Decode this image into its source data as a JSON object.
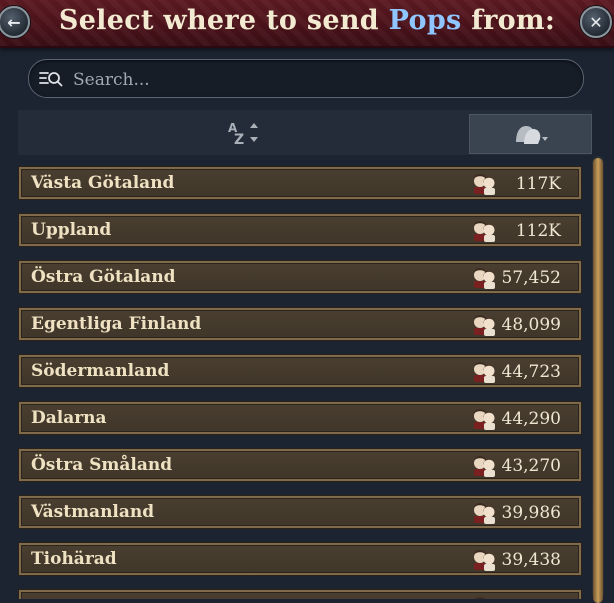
{
  "header": {
    "title_prefix": "Select where to send ",
    "title_accent": "Pops",
    "title_suffix": " from:",
    "back_icon": "←",
    "close_icon": "✕"
  },
  "search": {
    "placeholder": "Search...",
    "value": ""
  },
  "sort": {
    "az_label": "A Z"
  },
  "rows": [
    {
      "name": "Västa Götaland",
      "value": "117K"
    },
    {
      "name": "Uppland",
      "value": "112K"
    },
    {
      "name": "Östra Götaland",
      "value": "57,452"
    },
    {
      "name": "Egentliga Finland",
      "value": "48,099"
    },
    {
      "name": "Södermanland",
      "value": "44,723"
    },
    {
      "name": "Dalarna",
      "value": "44,290"
    },
    {
      "name": "Östra Småland",
      "value": "43,270"
    },
    {
      "name": "Västmanland",
      "value": "39,986"
    },
    {
      "name": "Tiohärad",
      "value": "39,438"
    },
    {
      "name": "",
      "value": ""
    }
  ],
  "colors": {
    "title_accent": "#8fc6ff",
    "row_bg": "#463b2d",
    "row_border": "#7f6a4c",
    "scroll_thumb": "#c79d5a"
  }
}
